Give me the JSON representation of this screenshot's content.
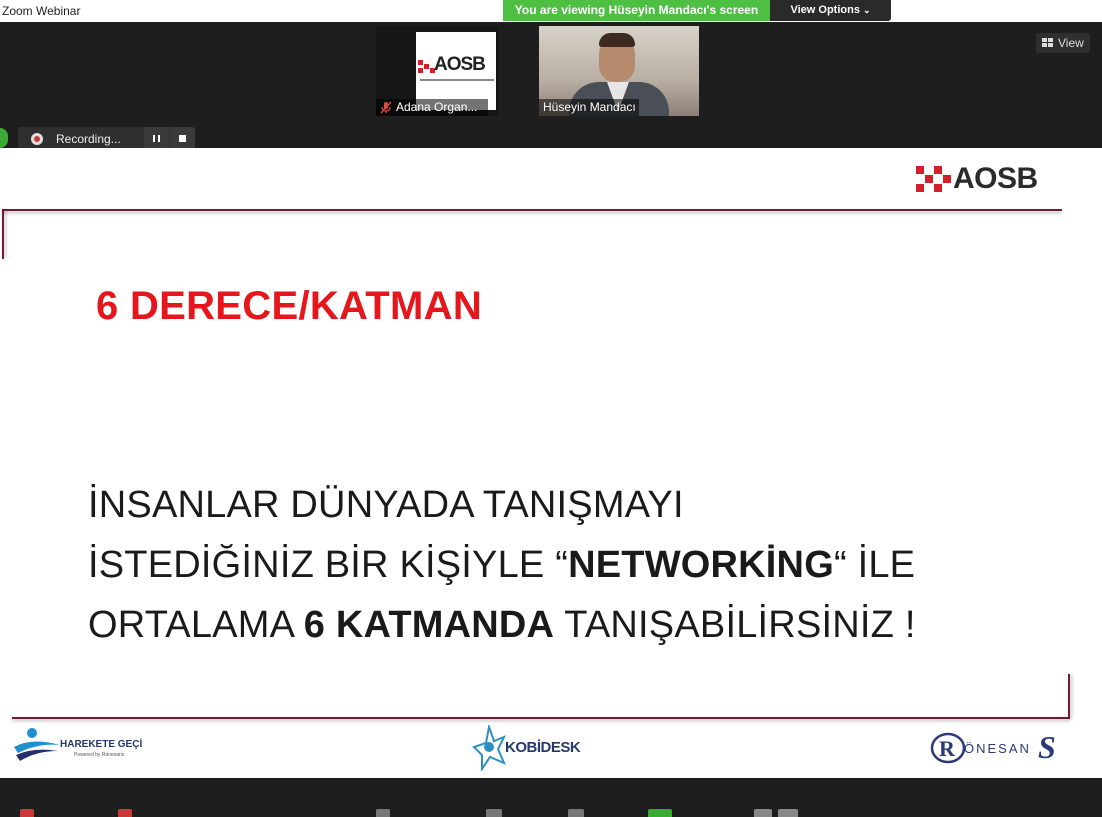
{
  "window": {
    "title": "Zoom Webinar"
  },
  "banner": {
    "viewing_text": "You are viewing Hüseyin Mandacı's screen",
    "view_options_label": "View Options",
    "view_options_icon": "chevron-down-icon"
  },
  "view_button": {
    "label": "View",
    "icon": "grid-icon"
  },
  "participants": [
    {
      "name": "Adana Organ...",
      "muted": true,
      "logo_text": "AOSB"
    },
    {
      "name": "Hüseyin Mandacı",
      "muted": false
    }
  ],
  "recording": {
    "label": "Recording...",
    "pause_icon": "pause-icon",
    "stop_icon": "stop-icon"
  },
  "slide": {
    "logo_text": "AOSB",
    "title": "6 DERECE/KATMAN",
    "body": {
      "line1": "İNSANLAR DÜNYADA TANIŞMAYI",
      "line2_a": "İSTEDİĞİNİZ BİR KİŞİYLE “",
      "line2_b": "NETWORKİNG",
      "line2_c": "“ İLE",
      "line3_a": "ORTALAMA ",
      "line3_b": "6 KATMANDA",
      "line3_c": " TANIŞABİLİRSİNİZ !"
    },
    "footer": {
      "harekete_text": "HAREKETE GEÇİ",
      "harekete_sub": "Powered by Rönesans",
      "kobidesk_text": "KOBİDESK",
      "ronesans_text": "ÖNESAN",
      "ronesans_s": "S"
    }
  },
  "colors": {
    "accent_green": "#4fbf44",
    "title_red": "#e5161c",
    "line_maroon": "#6e1a38"
  }
}
